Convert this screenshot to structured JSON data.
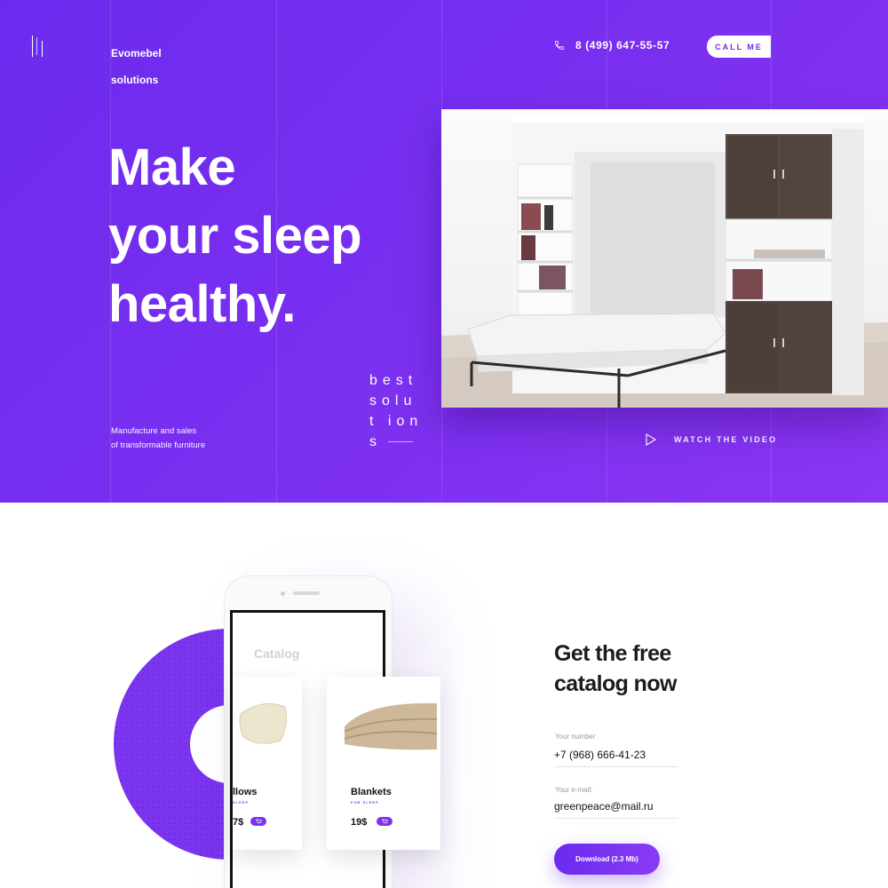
{
  "header": {
    "brand_line1": "Evomebel",
    "brand_line2": "solutions",
    "phone": "8 (499) 647-55-57",
    "call_label": "CALL ME"
  },
  "hero": {
    "headline_lines": [
      "Make",
      "your sleep",
      "healthy."
    ],
    "tagline_lines": [
      "Manufacture and sales",
      "of transformable furniture"
    ],
    "best_lines": [
      "best",
      "solu",
      "t ion",
      "s"
    ],
    "watch_label": "WATCH THE VIDEO"
  },
  "colors": {
    "accent": "#7030f0",
    "white": "#ffffff",
    "text_dark": "#1c1c1c"
  },
  "catalog": {
    "screen_title": "Catalog",
    "cards": [
      {
        "title": "Pillows",
        "visible_title": "llows",
        "sub": "SLEEP",
        "price": "7$"
      },
      {
        "title": "Blankets",
        "visible_title": "Blankets",
        "sub": "FOR SLEEP",
        "price": "19$"
      }
    ]
  },
  "form": {
    "title_lines": [
      "Get the free",
      "catalog now"
    ],
    "number_label": "Your number",
    "number_value": "+7 (968) 666-41-23",
    "email_label": "Your e-mail:",
    "email_value": "greenpeace@mail.ru",
    "download_label": "Download (2.3 Mb)"
  },
  "icons": [
    "phone-icon",
    "play-icon",
    "cart-icon",
    "logo-mark-icon"
  ]
}
